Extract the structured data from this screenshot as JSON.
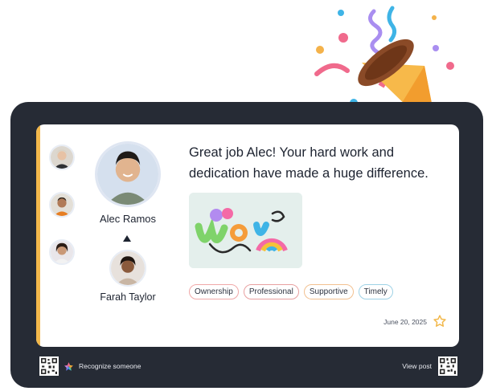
{
  "recipient": {
    "name": "Alec Ramos"
  },
  "sender": {
    "name": "Farah Taylor"
  },
  "message": "Great job Alec! Your hard work and dedication have made a huge difference.",
  "tags": [
    {
      "label": "Ownership",
      "color": "#f0a8a8"
    },
    {
      "label": "Professional",
      "color": "#e8a0a0"
    },
    {
      "label": "Supportive",
      "color": "#f2c090"
    },
    {
      "label": "Timely",
      "color": "#9ed2e6"
    }
  ],
  "date": "June 20, 2025",
  "footer": {
    "recognize_label": "Recognize someone",
    "view_post_label": "View post"
  },
  "colors": {
    "frame": "#262b35",
    "accent": "#f2b84b"
  }
}
